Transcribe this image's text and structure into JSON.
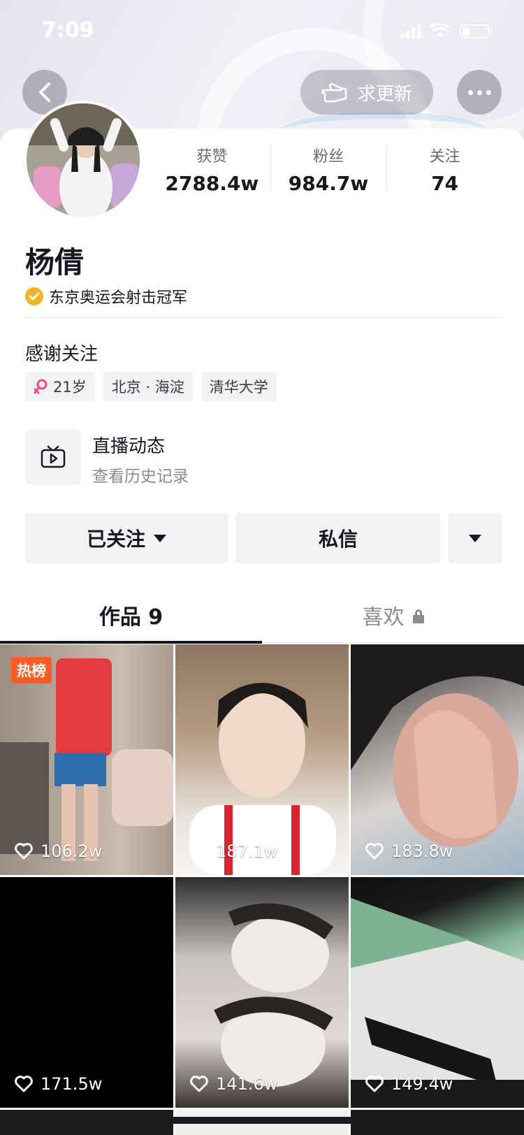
{
  "status_bar": {
    "time": "7:09"
  },
  "header": {
    "update_label": "求更新"
  },
  "profile": {
    "stats": [
      {
        "label": "获赞",
        "value": "2788.4w"
      },
      {
        "label": "粉丝",
        "value": "984.7w"
      },
      {
        "label": "关注",
        "value": "74"
      }
    ],
    "name": "杨倩",
    "verification": "东京奥运会射击冠军",
    "bio": "感谢关注",
    "tags": [
      {
        "icon": "female-icon",
        "label": "21岁"
      },
      {
        "label": "北京 · 海淀"
      },
      {
        "label": "清华大学"
      }
    ],
    "live": {
      "title": "直播动态",
      "subtitle": "查看历史记录"
    }
  },
  "actions": {
    "follow_label": "已关注",
    "message_label": "私信"
  },
  "tabs": [
    {
      "label": "作品 9",
      "active": true
    },
    {
      "label": "喜欢",
      "active": false,
      "locked": true
    }
  ],
  "videos": [
    {
      "likes": "106.2w",
      "badge": "热榜"
    },
    {
      "likes": "187.1w"
    },
    {
      "likes": "183.8w"
    },
    {
      "likes": "171.5w"
    },
    {
      "likes": "141.6w"
    },
    {
      "likes": "149.4w"
    }
  ],
  "colors": {
    "verified_badge": "#f5b324",
    "hot_badge": "#fe5c26",
    "text_primary": "#161823"
  }
}
